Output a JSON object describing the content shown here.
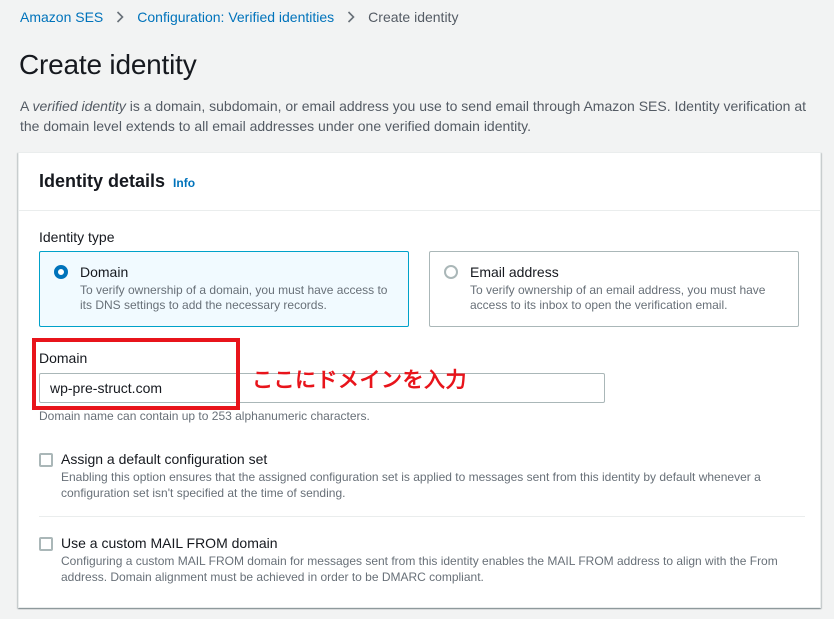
{
  "breadcrumb": {
    "items": [
      "Amazon SES",
      "Configuration: Verified identities"
    ],
    "current": "Create identity"
  },
  "page": {
    "title": "Create identity",
    "desc_prefix": "A ",
    "desc_emphasis": "verified identity",
    "desc_rest": " is a domain, subdomain, or email address you use to send email through Amazon SES. Identity verification at the domain level extends to all email addresses under one verified domain identity."
  },
  "panel": {
    "title": "Identity details",
    "info": "Info",
    "identity_type_label": "Identity type",
    "options": [
      {
        "title": "Domain",
        "desc": "To verify ownership of a domain, you must have access to its DNS settings to add the necessary records.",
        "selected": true
      },
      {
        "title": "Email address",
        "desc": "To verify ownership of an email address, you must have access to its inbox to open the verification email.",
        "selected": false
      }
    ],
    "domain_label": "Domain",
    "domain_value": "wp-pre-struct.com",
    "domain_constraint": "Domain name can contain up to 253 alphanumeric characters.",
    "checkboxes": [
      {
        "title": "Assign a default configuration set",
        "desc": "Enabling this option ensures that the assigned configuration set is applied to messages sent from this identity by default whenever a configuration set isn't specified at the time of sending.",
        "checked": false
      },
      {
        "title": "Use a custom MAIL FROM domain",
        "desc": "Configuring a custom MAIL FROM domain for messages sent from this identity enables the MAIL FROM address to align with the From address. Domain alignment must be achieved in order to be DMARC compliant.",
        "checked": false
      }
    ]
  },
  "annotation": {
    "text": "ここにドメインを入力",
    "color": "#e8141b"
  },
  "colors": {
    "link": "#0073bb",
    "selected_border": "#00a1c9",
    "selected_bg": "#f1faff",
    "background": "#f2f3f3"
  }
}
